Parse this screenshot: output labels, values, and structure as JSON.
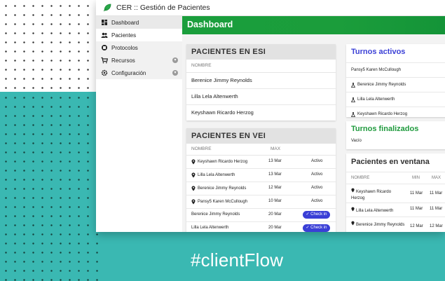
{
  "hashtag": "#clientFlow",
  "app": {
    "title": "CER :: Gestión de Pacientes"
  },
  "sidebar": {
    "items": [
      {
        "label": "Dashboard",
        "icon": "dashboard-icon"
      },
      {
        "label": "Pacientes",
        "icon": "users-icon"
      },
      {
        "label": "Protocolos",
        "icon": "protocol-icon"
      },
      {
        "label": "Recursos",
        "icon": "cart-icon"
      },
      {
        "label": "Configuración",
        "icon": "gear-icon"
      }
    ]
  },
  "header": {
    "title": "Dashboard"
  },
  "en_espera": {
    "title": "PACIENTES EN ESI",
    "column": "NOMBRE",
    "rows": [
      "Berenice Jimmy Reynolds",
      "Lilla Lela Altenwerth",
      "Keyshawn Ricardo Herzog"
    ]
  },
  "en_ventanilla": {
    "title": "PACIENTES EN VEI",
    "columns": {
      "nombre": "NOMBRE",
      "max": "MAX"
    },
    "rows": [
      {
        "name": "Keyshawn Ricardo Herzog",
        "date": "13 Mar",
        "status": "Activo",
        "pin": true
      },
      {
        "name": "Lilla Lela Altenwerth",
        "date": "13 Mar",
        "status": "Activo",
        "pin": true
      },
      {
        "name": "Berenice Jimmy Reynolds",
        "date": "12 Mar",
        "status": "Activo",
        "pin": true
      },
      {
        "name": "Pansy5 Karen McCullough",
        "date": "10 Mar",
        "status": "Activo",
        "pin": true
      },
      {
        "name": "Berenice Jimmy Reynolds",
        "date": "20 Mar",
        "status": "Check in",
        "pin": false
      },
      {
        "name": "Lilla Lela Altenwerth",
        "date": "20 Mar",
        "status": "Check in",
        "pin": false
      }
    ]
  },
  "turnos_activos": {
    "title": "Turnos activos",
    "rows": [
      {
        "name": "Pansy5 Karen McCullough",
        "icon": ""
      },
      {
        "name": "Berenice Jimmy Reynolds",
        "icon": "lab-icon"
      },
      {
        "name": "Lilla Lela Altenwerth",
        "icon": "lab-icon"
      },
      {
        "name": "Keyshawn Ricardo Herzog",
        "icon": "lab-icon"
      }
    ]
  },
  "turnos_finalizados": {
    "title": "Turnos finalizados",
    "empty": "Vacío"
  },
  "pacientes_ventana": {
    "title": "Pacientes en ventana",
    "columns": {
      "nombre": "NOMBRE",
      "min": "MIN",
      "max": "MAX"
    },
    "rows": [
      {
        "name": "Keyshawn Ricardo Herzog",
        "min": "11 Mar",
        "max": "11 Mar"
      },
      {
        "name": "Lilla Lela Altenwerth",
        "min": "11 Mar",
        "max": "11 Mar"
      },
      {
        "name": "Berenice Jimmy Reynolds",
        "min": "12 Mar",
        "max": "12 Mar"
      }
    ]
  },
  "colors": {
    "accent_green": "#1b9d3b",
    "accent_blue": "#3a3fd6",
    "teal_background": "#3ab8b2"
  }
}
